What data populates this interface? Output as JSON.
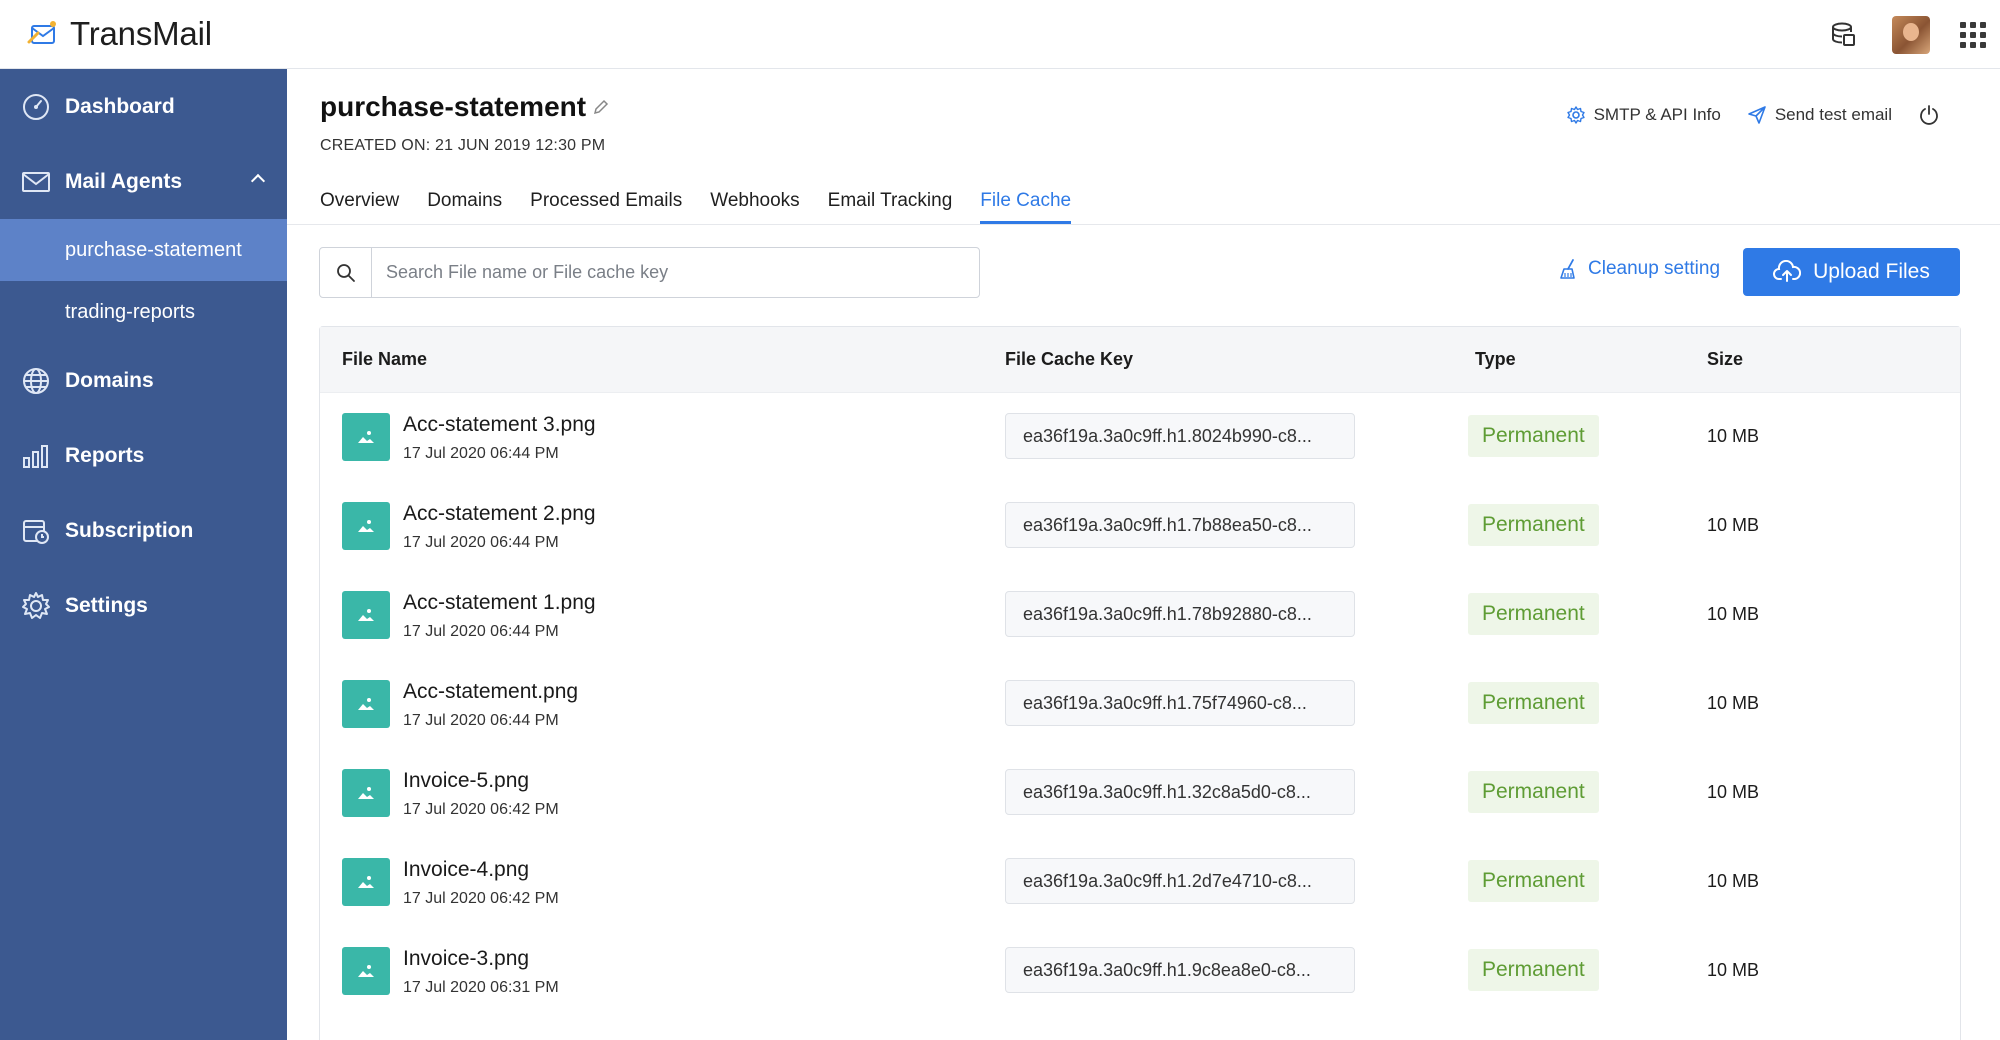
{
  "app": {
    "name": "TransMail"
  },
  "topbar": {
    "icons": [
      "database-icon",
      "avatar",
      "apps-grid-icon"
    ]
  },
  "sidebar": {
    "items": [
      {
        "label": "Dashboard",
        "icon": "dashboard-icon"
      },
      {
        "label": "Mail Agents",
        "icon": "mail-icon",
        "expanded": true,
        "children": [
          {
            "label": "purchase-statement",
            "active": true
          },
          {
            "label": "trading-reports",
            "active": false
          }
        ]
      },
      {
        "label": "Domains",
        "icon": "globe-icon"
      },
      {
        "label": "Reports",
        "icon": "bar-chart-icon"
      },
      {
        "label": "Subscription",
        "icon": "subscription-icon"
      },
      {
        "label": "Settings",
        "icon": "gear-icon"
      }
    ]
  },
  "header": {
    "title": "purchase-statement",
    "created": "CREATED ON: 21 JUN 2019 12:30 PM",
    "smtp_label": "SMTP & API Info",
    "test_label": "Send test email"
  },
  "tabs": [
    {
      "label": "Overview",
      "active": false
    },
    {
      "label": "Domains",
      "active": false
    },
    {
      "label": "Processed Emails",
      "active": false
    },
    {
      "label": "Webhooks",
      "active": false
    },
    {
      "label": "Email Tracking",
      "active": false
    },
    {
      "label": "File Cache",
      "active": true
    }
  ],
  "toolbar": {
    "search_placeholder": "Search File name or File cache key",
    "cleanup_label": "Cleanup setting",
    "upload_label": "Upload Files"
  },
  "table": {
    "headers": {
      "name": "File Name",
      "key": "File Cache Key",
      "type": "Type",
      "size": "Size"
    },
    "rows": [
      {
        "name": "Acc-statement 3.png",
        "date": "17 Jul 2020 06:44 PM",
        "key": "ea36f19a.3a0c9ff.h1.8024b990-c8...",
        "type": "Permanent",
        "size": "10 MB"
      },
      {
        "name": "Acc-statement 2.png",
        "date": "17 Jul 2020 06:44 PM",
        "key": "ea36f19a.3a0c9ff.h1.7b88ea50-c8...",
        "type": "Permanent",
        "size": "10 MB"
      },
      {
        "name": "Acc-statement 1.png",
        "date": "17 Jul 2020 06:44 PM",
        "key": "ea36f19a.3a0c9ff.h1.78b92880-c8...",
        "type": "Permanent",
        "size": "10 MB"
      },
      {
        "name": "Acc-statement.png",
        "date": "17 Jul 2020 06:44 PM",
        "key": "ea36f19a.3a0c9ff.h1.75f74960-c8...",
        "type": "Permanent",
        "size": "10 MB"
      },
      {
        "name": "Invoice-5.png",
        "date": "17 Jul 2020 06:42 PM",
        "key": "ea36f19a.3a0c9ff.h1.32c8a5d0-c8...",
        "type": "Permanent",
        "size": "10 MB"
      },
      {
        "name": "Invoice-4.png",
        "date": "17 Jul 2020 06:42 PM",
        "key": "ea36f19a.3a0c9ff.h1.2d7e4710-c8...",
        "type": "Permanent",
        "size": "10 MB"
      },
      {
        "name": "Invoice-3.png",
        "date": "17 Jul 2020 06:31 PM",
        "key": "ea36f19a.3a0c9ff.h1.9c8ea8e0-c8...",
        "type": "Permanent",
        "size": "10 MB"
      }
    ]
  },
  "colors": {
    "sidebar": "#3c5990",
    "sidebar_active": "#5d82c8",
    "accent": "#2f7ae6",
    "thumb": "#3ab7a8",
    "badge_text": "#5e9c34"
  }
}
